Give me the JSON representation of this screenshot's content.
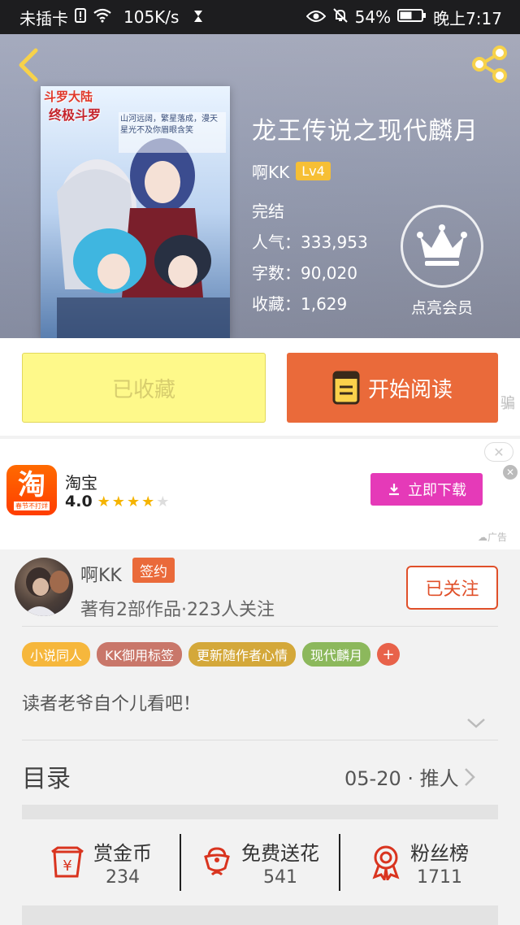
{
  "status_bar": {
    "carrier": "未插卡",
    "speed": "105K/s",
    "battery": "54%",
    "time": "晚上7:17"
  },
  "book": {
    "title": "龙王传说之现代麟月",
    "author": "啊KK",
    "level": "Lv4",
    "status": "完结",
    "popularity": "人气：333,953",
    "word_count": "字数：90,020",
    "favorites": "收藏：1,629",
    "vip_label": "点亮会员",
    "cover_title_text": "斗罗大陆",
    "cover_subtitle_text": "终极斗罗",
    "cover_blurb": "山河远阔，繁星落成，漫天星光不及你眉眼含笑"
  },
  "actions": {
    "collected_label": "已收藏",
    "read_label": "开始阅读",
    "peek_text": "骗"
  },
  "ad": {
    "app_name": "淘宝",
    "logo_char": "淘",
    "logo_sub": "春节不打烊",
    "rating": "4.0",
    "stars_filled": 4,
    "stars_total": 5,
    "download_label": "立即下载",
    "close_symbol": "✕",
    "ad_tag": "广告"
  },
  "author": {
    "name": "啊KK",
    "sign_badge": "签约",
    "info": "著有2部作品·223人关注",
    "follow_label": "已关注",
    "tags": [
      {
        "label": "小说同人",
        "color": "#f6b73c"
      },
      {
        "label": "KK御用标签",
        "color": "#c9776a"
      },
      {
        "label": "更新随作者心情",
        "color": "#d4a83a"
      },
      {
        "label": "现代麟月",
        "color": "#8cb85c"
      }
    ],
    "tag_add": "+",
    "description": "读者老爷自个儿看吧！"
  },
  "toc": {
    "title": "目录",
    "latest": "05-20 · 推人"
  },
  "stats": [
    {
      "label": "赏金币",
      "value": "234",
      "icon": "reward-coin-icon"
    },
    {
      "label": "免费送花",
      "value": "541",
      "icon": "flower-icon"
    },
    {
      "label": "粉丝榜",
      "value": "1711",
      "icon": "medal-icon"
    }
  ],
  "colors": {
    "accent": "#ea6a3a",
    "collect_bg": "#fef98a",
    "ad_button": "#e53ab8",
    "level_badge": "#f6bf35",
    "icon_red": "#d9341f"
  }
}
